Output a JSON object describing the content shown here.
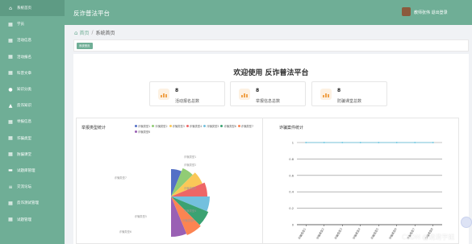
{
  "app": {
    "title": "反诈普法平台"
  },
  "user": {
    "info": "教师张伟 退出登录"
  },
  "sidebar": {
    "items": [
      {
        "label": "系统首页",
        "icon": "home-icon"
      },
      {
        "label": "学员",
        "icon": "grid-icon"
      },
      {
        "label": "活动信息",
        "icon": "grid-icon"
      },
      {
        "label": "活动报名",
        "icon": "grid-icon"
      },
      {
        "label": "科普文章",
        "icon": "grid-icon"
      },
      {
        "label": "知识分类",
        "icon": "user-icon"
      },
      {
        "label": "反诈知识",
        "icon": "chart-icon"
      },
      {
        "label": "举报信息",
        "icon": "grid-icon"
      },
      {
        "label": "诈骗类型",
        "icon": "grid-icon"
      },
      {
        "label": "防骗课堂",
        "icon": "grid-icon"
      },
      {
        "label": "试题库管理",
        "icon": "book-icon"
      },
      {
        "label": "交流论坛",
        "icon": "list-icon"
      },
      {
        "label": "反诈测试管理",
        "icon": "grid-icon"
      },
      {
        "label": "试题管理",
        "icon": "grid-icon"
      }
    ]
  },
  "breadcrumb": {
    "home": "首页",
    "separator": "/",
    "current": "系统首页"
  },
  "tabs": {
    "active": "系统首页"
  },
  "welcome": "欢迎使用 反诈普法平台",
  "stats": [
    {
      "value": "8",
      "label": "活动报名总数"
    },
    {
      "value": "8",
      "label": "举报信息总数"
    },
    {
      "value": "8",
      "label": "防骗课堂总数"
    }
  ],
  "pie_chart": {
    "title": "举报类型统计",
    "legend": [
      "诈骗类型1",
      "诈骗类型2",
      "诈骗类型3",
      "诈骗类型4",
      "诈骗类型5",
      "诈骗类型6",
      "诈骗类型7",
      "诈骗类型8"
    ],
    "outer_labels": [
      "诈骗类型1",
      "诈骗类型2",
      "诈骗类型3",
      "诈骗类型4",
      "诈骗类型5",
      "诈骗类型6",
      "诈骗类型7",
      "诈骗类型8"
    ],
    "colors": [
      "#5470c6",
      "#91cc75",
      "#fac858",
      "#ee6666",
      "#73c0de",
      "#3ba272",
      "#fc8452",
      "#9a60b4"
    ]
  },
  "line_chart": {
    "title": "诈骗案件统计"
  },
  "chart_data": [
    {
      "type": "pie",
      "title": "举报类型统计",
      "categories": [
        "诈骗类型1",
        "诈骗类型2",
        "诈骗类型3",
        "诈骗类型4",
        "诈骗类型5",
        "诈骗类型6",
        "诈骗类型7",
        "诈骗类型8"
      ],
      "values": [
        1,
        1,
        1,
        1,
        1,
        1,
        1,
        1
      ],
      "legend": "top"
    },
    {
      "type": "line",
      "title": "诈骗案件统计",
      "categories": [
        "诈骗类型1",
        "诈骗类型2",
        "诈骗类型3",
        "诈骗类型4",
        "诈骗类型5",
        "诈骗类型6",
        "诈骗类型7",
        "诈骗类型8"
      ],
      "values": [
        1,
        1,
        1,
        1,
        1,
        1,
        1,
        1
      ],
      "yticks": [
        "0",
        "0.2",
        "0.4",
        "0.6",
        "0.8",
        "1"
      ],
      "ylim": [
        0,
        1
      ],
      "grid": true,
      "color": "#5bc0de"
    }
  ],
  "watermark": "CSDN @清清学姐"
}
